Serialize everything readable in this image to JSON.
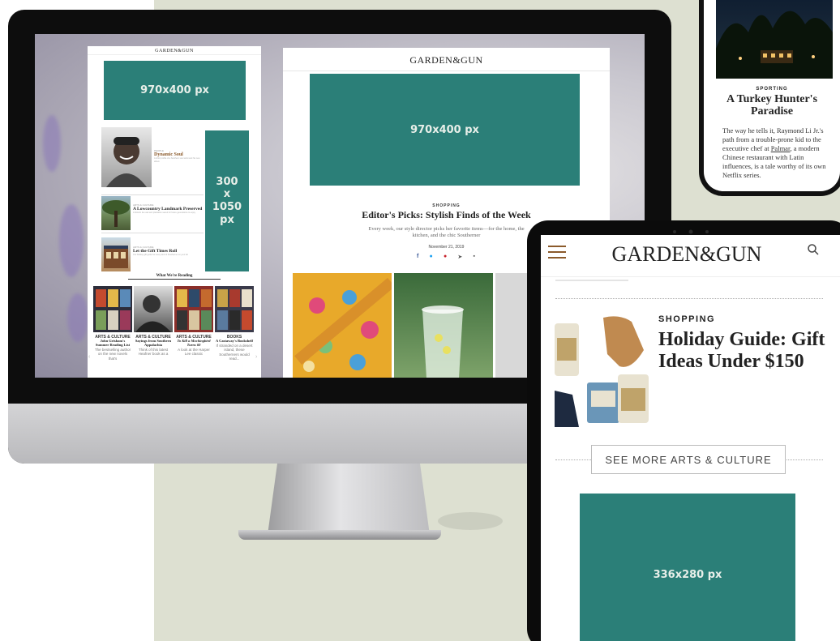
{
  "imac": {
    "left_page": {
      "logo": "GARDEN&GUN",
      "ad_top": "970x400 px",
      "ad_side": [
        "300",
        "x",
        "1050",
        "px"
      ],
      "stories": [
        {
          "label": "PEOPLE",
          "title": "Dynamic Soul",
          "blurb": "A short profile of a Southern soul artist and his new album"
        },
        {
          "label": "ARTS & CULTURE",
          "title": "A Lowcountry Landmark Preserved",
          "blurb": "A historic live oak and plantation saved for future generations to enjoy"
        },
        {
          "label": "ARTS & CULTURE",
          "title": "Let the Gift Times Roll",
          "blurb": "Our holiday gift guide for every kind of Southerner on your list"
        }
      ],
      "reading_heading": "What We're Reading",
      "books": [
        {
          "category": "ARTS & CULTURE",
          "title": "John Grisham's Summer Reading List",
          "blurb": "The bestselling author on the new novels that's"
        },
        {
          "category": "ARTS & CULTURE",
          "title": "Sayings from Southern Appalachia",
          "blurb": "Think of this latest Heafner book as a"
        },
        {
          "category": "ARTS & CULTURE",
          "title": "To Kill a Mockingbird Turns 60",
          "blurb": "A look at the Harper Lee classic"
        },
        {
          "category": "BOOKS",
          "title": "A Castaway's Bookshelf",
          "blurb": "If stranded on a desert island, these Southerners would read..."
        }
      ]
    },
    "right_page": {
      "logo": "GARDEN&GUN",
      "ad": "970x400 px",
      "category": "SHOPPING",
      "headline": "Editor's Picks: Stylish Finds of the Week",
      "dek": "Every week, our style director picks her favorite items—for the home, the kitchen, and the chic Southerner",
      "date": "November 21, 2019"
    }
  },
  "phone": {
    "category": "SPORTING",
    "headline": "A Turkey Hunter's Paradise",
    "body_before": "The way he tells it, Raymond Li Jr.'s path from a trouble-prone kid to the executive chef at ",
    "body_link": "Palmar",
    "body_after": ", a modern Chinese restaurant with Latin influences, is a tale worthy of its own Netflix series."
  },
  "ipad": {
    "logo": "GARDEN&GUN",
    "category": "SHOPPING",
    "headline": "Holiday Guide: Gift Ideas Under $150",
    "see_more": "SEE MORE ARTS & CULTURE",
    "ad": "336x280 px"
  },
  "colors": {
    "ad_green": "#2b7f78",
    "menu_brown": "#8b5a2b",
    "sage_background": "#dde0d1"
  }
}
